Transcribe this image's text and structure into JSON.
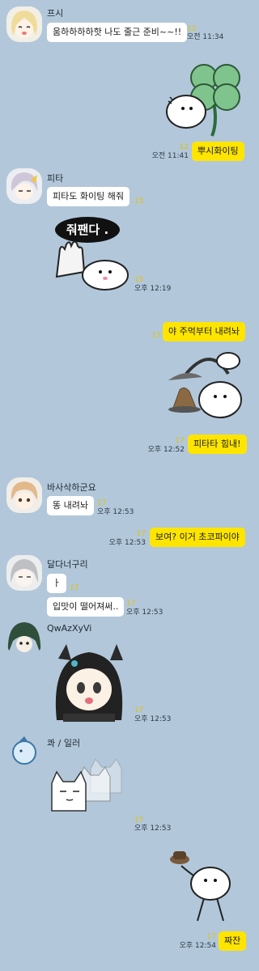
{
  "messages": [
    {
      "sender": "프시",
      "text": "움하하하하핫 나도 줄근 준비~~!!",
      "unread": "12",
      "time": "오전 11:34"
    },
    {
      "sticker": "hamster-clover-sticker",
      "mine": true
    },
    {
      "mine": true,
      "text": "뿌시화이팅",
      "unread": "12",
      "time": "오전 11:41"
    },
    {
      "sender": "피타",
      "text": "피타도 화이팅 해줘",
      "unread": "15"
    },
    {
      "sticker": "hamster-wave-sticker",
      "sticker_text": "줘팬다 .",
      "unread": "15",
      "time": "오후 12:19"
    },
    {
      "mine": true,
      "text": "야 주먹부터 내려놔",
      "unread": "17"
    },
    {
      "sticker": "hamster-chef-sticker",
      "mine": true
    },
    {
      "mine": true,
      "text": "피타타 힘내!",
      "unread": "17",
      "time": "오후 12:52"
    },
    {
      "sender": "바사삭하군요",
      "text": "똥 내려놔",
      "unread": "17",
      "time": "오후 12:53"
    },
    {
      "mine": true,
      "text": "보여? 이거 초코파이야",
      "unread": "17",
      "time": "오후 12:53"
    },
    {
      "sender": "달다너구리",
      "text": "ㅏ",
      "unread": "17"
    },
    {
      "text": "입맛이 떨어져써..",
      "unread": "17",
      "time": "오후 12:53"
    },
    {
      "sender": "QwAzXyVi",
      "sticker": "anime-girl-sticker",
      "unread": "17",
      "time": "오후 12:53"
    },
    {
      "sender": "콰 / 일러",
      "sticker": "cat-stare-sticker",
      "unread": "17",
      "time": "오후 12:53"
    },
    {
      "sticker": "hamster-hat-sticker",
      "mine": true
    },
    {
      "mine": true,
      "text": "짜잔",
      "unread": "17",
      "time": "오후 12:54"
    }
  ],
  "colors": {
    "background": "#b2c7da",
    "my_bubble": "#fee500",
    "their_bubble": "#ffffff",
    "unread_count": "#e2c300"
  }
}
